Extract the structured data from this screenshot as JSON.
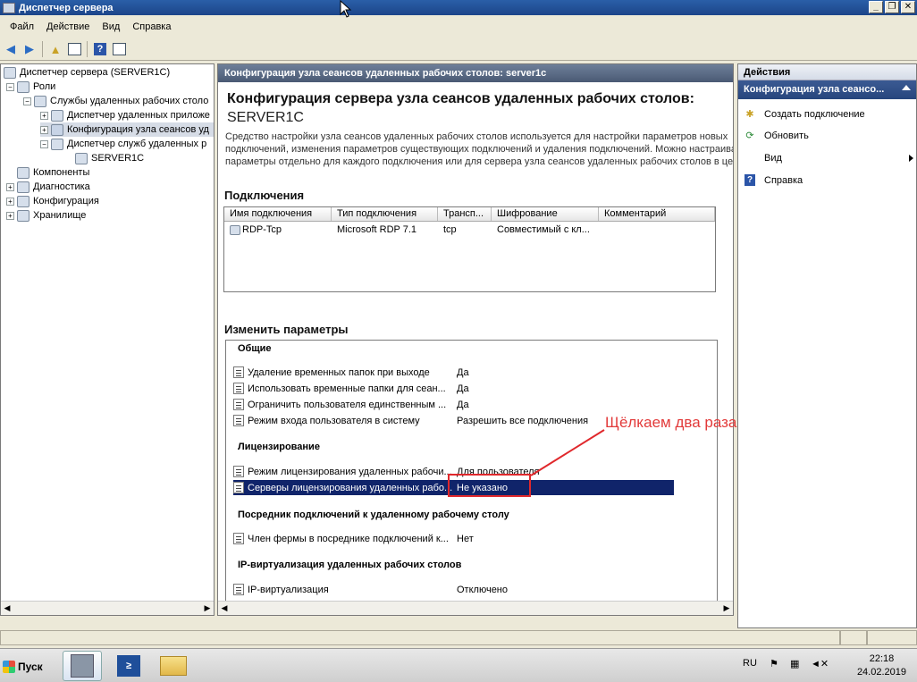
{
  "window": {
    "title": "Диспетчер сервера",
    "btn_min": "_",
    "btn_max": "❐",
    "btn_close": "✕"
  },
  "menu": [
    "Файл",
    "Действие",
    "Вид",
    "Справка"
  ],
  "tree": {
    "root": "Диспетчер сервера (SERVER1C)",
    "roles": "Роли",
    "rds": "Службы удаленных рабочих столо",
    "remoteapp": "Диспетчер удаленных приложе",
    "rdsh_config": "Конфигурация узла сеансов уд",
    "licensing": "Диспетчер служб удаленных р",
    "server": "SERVER1C",
    "components": "Компоненты",
    "diagnostics": "Диагностика",
    "configuration": "Конфигурация",
    "storage": "Хранилище"
  },
  "center": {
    "header": "Конфигурация узла сеансов удаленных рабочих столов: server1c",
    "title": "Конфигурация сервера узла сеансов удаленных рабочих столов:",
    "server": "SERVER1C",
    "desc1": "Средство настройки узла сеансов удаленных рабочих столов используется для настройки параметров новых",
    "desc2": "подключений, изменения параметров существующих подключений и удаления подключений. Можно настраива",
    "desc3": "параметры отдельно для каждого подключения или для сервера узла сеансов удаленных рабочих столов в цел",
    "connections_title": "Подключения",
    "columns": [
      "Имя подключения",
      "Тип подключения",
      "Трансп...",
      "Шифрование",
      "Комментарий"
    ],
    "row": [
      "RDP-Tcp",
      "Microsoft RDP 7.1",
      "tcp",
      "Совместимый с кл...",
      ""
    ],
    "params_title": "Изменить параметры",
    "groups": {
      "general": "Общие",
      "licensing": "Лицензирование",
      "broker": "Посредник подключений к удаленному рабочему столу",
      "ipvirt": "IP-виртуализация удаленных рабочих столов"
    },
    "params": [
      {
        "name": "Удаление временных папок при выходе",
        "value": "Да"
      },
      {
        "name": "Использовать временные папки для сеан...",
        "value": "Да"
      },
      {
        "name": "Ограничить пользователя единственным ...",
        "value": "Да"
      },
      {
        "name": "Режим входа пользователя в систему",
        "value": "Разрешить все подключения"
      },
      {
        "name": "Режим лицензирования удаленных рабочи...",
        "value": "Для пользователя"
      },
      {
        "name": "Серверы лицензирования удаленных рабо...",
        "value": "Не указано"
      },
      {
        "name": "Член фермы в посреднике подключений к...",
        "value": "Нет"
      },
      {
        "name": "IP-виртуализация",
        "value": "Отключено"
      }
    ],
    "annotation": "Щёлкаем два раза"
  },
  "actions": {
    "header": "Действия",
    "sub": "Конфигурация узла сеансо...",
    "items": [
      "Создать подключение",
      "Обновить",
      "Вид",
      "Справка"
    ]
  },
  "taskbar": {
    "start": "Пуск",
    "lang": "RU",
    "time": "22:18",
    "date": "24.02.2019"
  },
  "colors": {
    "selected_row": "#10246a",
    "annotation": "#e0282c",
    "header": "#4a5a74"
  }
}
